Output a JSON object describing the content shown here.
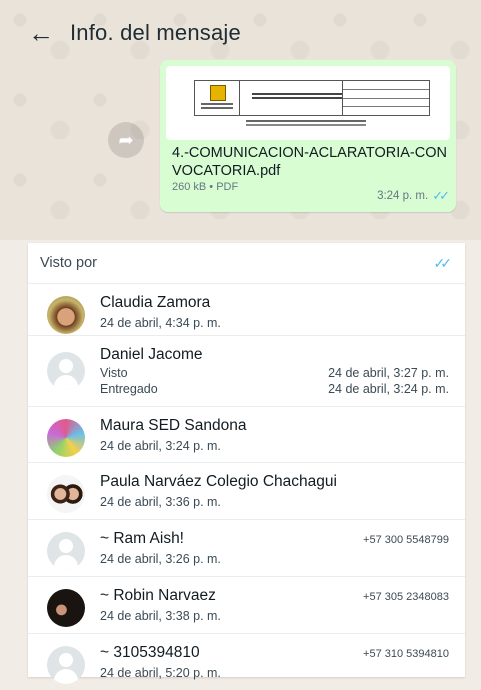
{
  "header": {
    "back_icon": "arrow-left-icon",
    "title": "Info. del mensaje"
  },
  "message": {
    "file_name": "4.-COMUNICACION-ACLARATORIA-CONVOCATORIA.pdf",
    "file_meta": "260 kB • PDF",
    "time": "3:24 p. m.",
    "ticks_icon": "double-check-icon",
    "forward_icon": "forward-icon",
    "bubble_color": "#d9fdd3",
    "tick_color": "#53bdeb"
  },
  "seen_section": {
    "title": "Visto por",
    "readers": [
      {
        "name": "Claudia Zamora",
        "sub": "24 de abril, 4:34 p. m."
      },
      {
        "name": "Daniel Jacome",
        "seen_label": "Visto",
        "seen_time": "24 de abril, 3:27 p. m.",
        "delivered_label": "Entregado",
        "delivered_time": "24 de abril, 3:24 p. m."
      },
      {
        "name": "Maura SED Sandona",
        "sub": "24 de abril, 3:24 p. m."
      },
      {
        "name": "Paula Narváez Colegio Chachagui",
        "sub": "24 de abril, 3:36 p. m."
      },
      {
        "name": "~ Ram Aish!",
        "phone": "+57 300 5548799",
        "sub": "24 de abril, 3:26 p. m."
      },
      {
        "name": "~ Robin Narvaez",
        "phone": "+57 305 2348083",
        "sub": "24 de abril, 3:38 p. m."
      },
      {
        "name": "~ 3105394810",
        "phone": "+57 310 5394810",
        "sub": "24 de abril, 5:20 p. m."
      }
    ]
  }
}
